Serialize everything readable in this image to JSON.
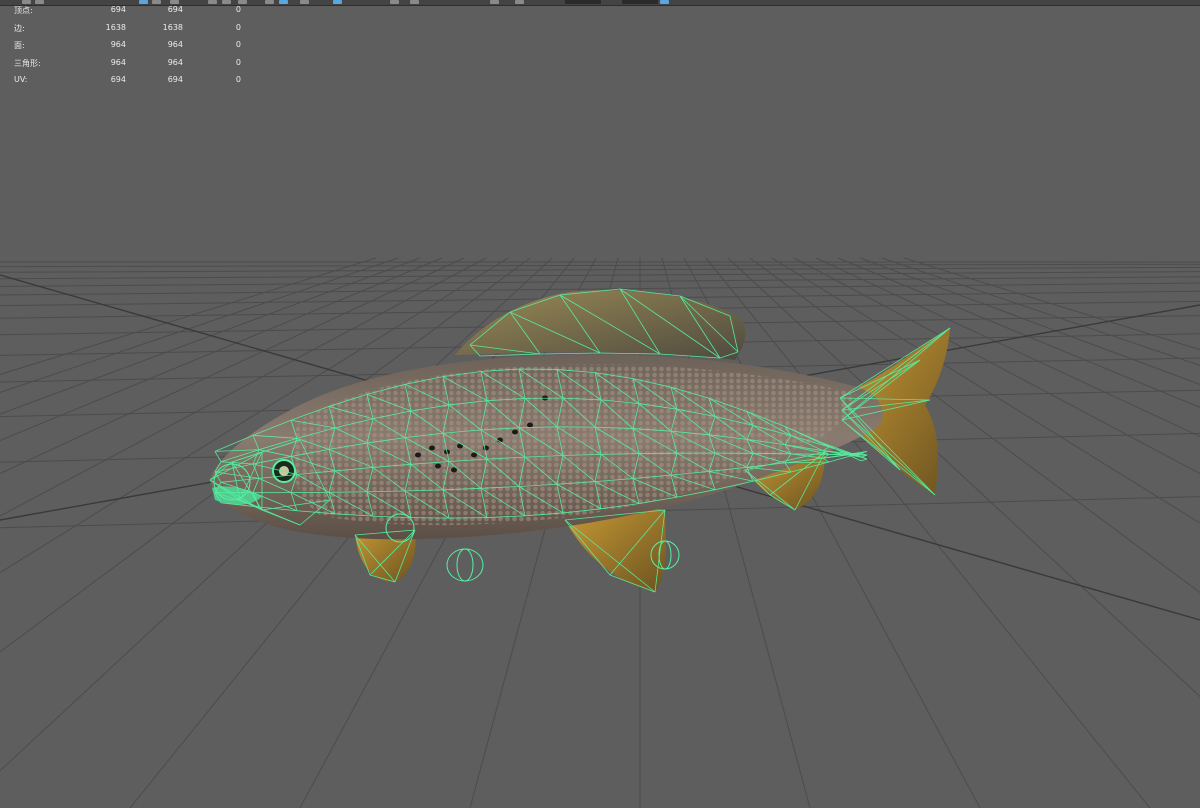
{
  "hud": {
    "rows": [
      {
        "label": "顶点:",
        "values": [
          "694",
          "694",
          "0"
        ]
      },
      {
        "label": "边:",
        "values": [
          "1638",
          "1638",
          "0"
        ]
      },
      {
        "label": "面:",
        "values": [
          "964",
          "964",
          "0"
        ]
      },
      {
        "label": "三角形:",
        "values": [
          "964",
          "964",
          "0"
        ]
      },
      {
        "label": "UV:",
        "values": [
          "694",
          "694",
          "0"
        ]
      }
    ]
  },
  "colors": {
    "viewport_bg": "#5e5e5e",
    "grid_line": "#4c4c4c",
    "grid_axis": "#3a3a3a",
    "wireframe": "#56f0a0",
    "fish_body": "#7a6a5e",
    "fish_belly": "#9a8f86",
    "fin": "#b88a2a",
    "highlight": "#5aa7e0"
  },
  "icons": [
    "select-tool-icon",
    "move-tool-icon",
    "rotate-tool-icon",
    "scale-tool-icon",
    "camera-icon",
    "wireframe-icon",
    "shaded-icon",
    "texture-icon",
    "light-icon",
    "isolate-icon",
    "xray-icon",
    "grid-icon"
  ]
}
